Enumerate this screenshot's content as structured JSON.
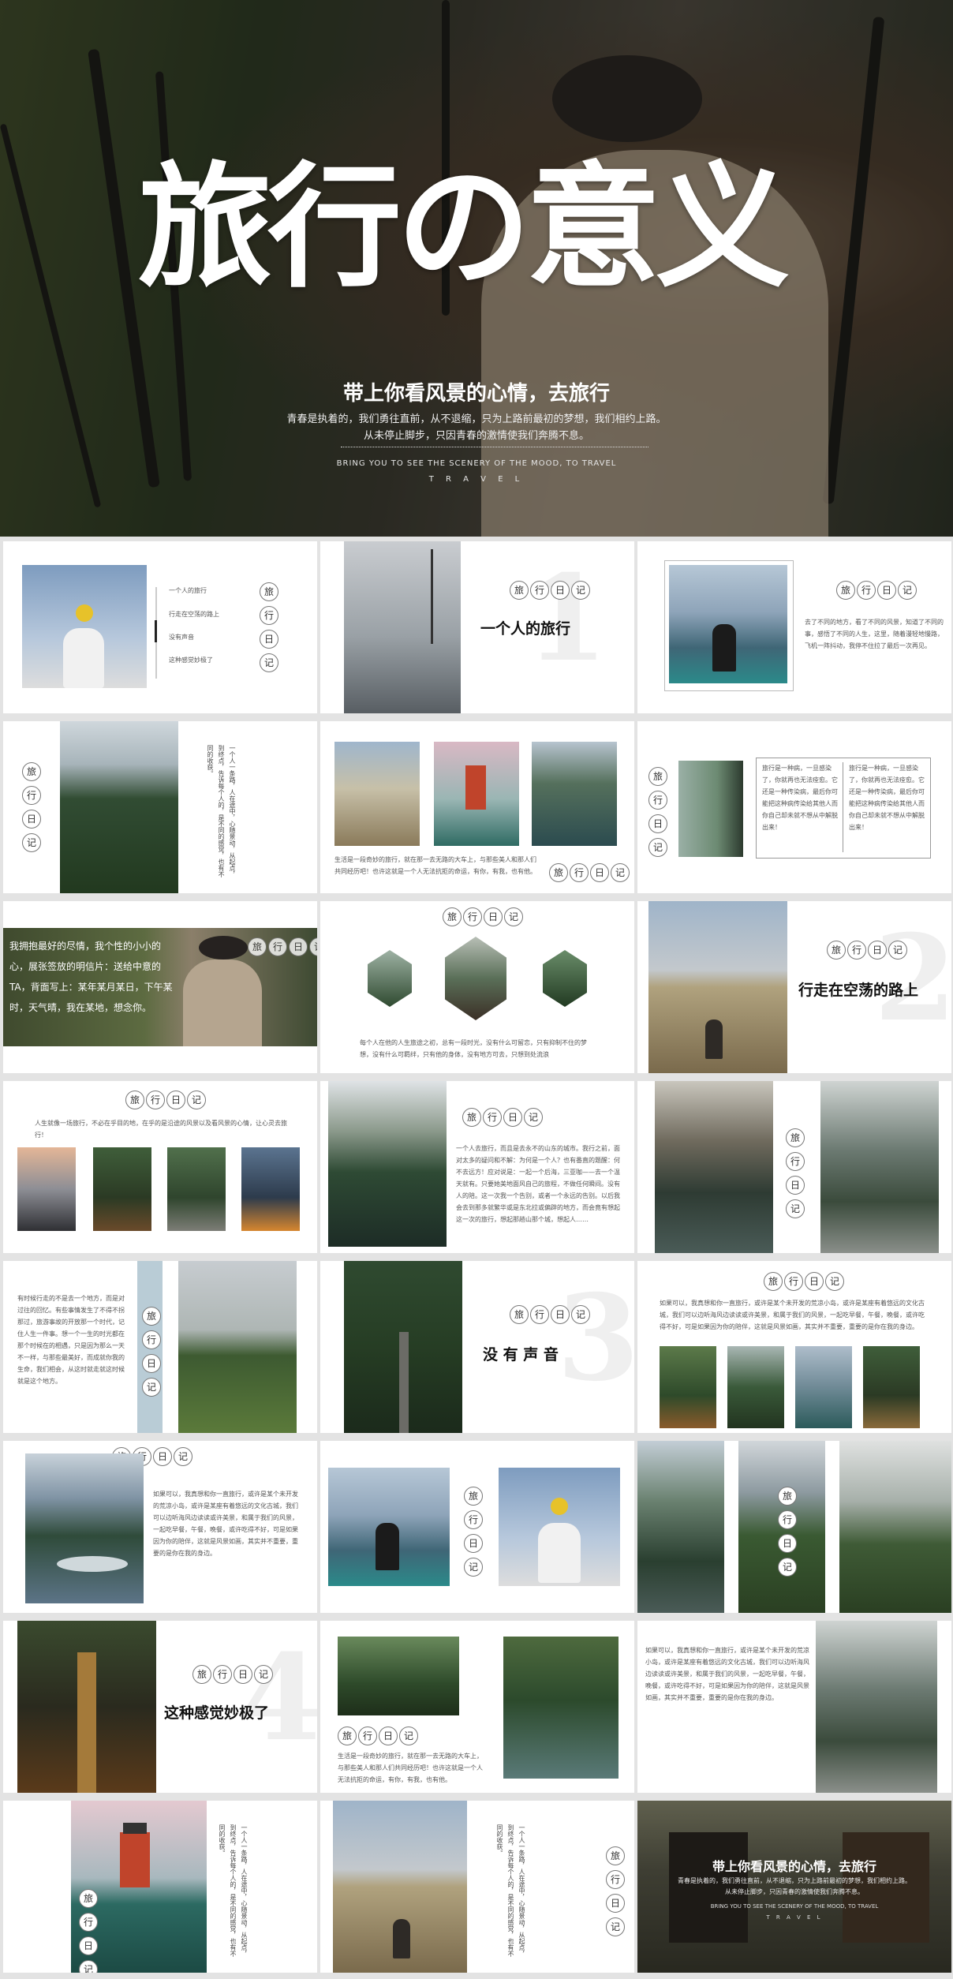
{
  "hero": {
    "title": "旅行の意义",
    "subtitle": "带上你看风景的心情，去旅行",
    "line1": "青春是执着的，我们勇往直前，从不退缩，只为上路前最初的梦想，我们相约上路。",
    "line2": "从未停止脚步，只因青春的激情使我们奔腾不息。",
    "en1": "BRING YOU TO SEE THE SCENERY OF THE MOOD, TO TRAVEL",
    "en2": "T R A V E L"
  },
  "badge": [
    "旅",
    "行",
    "日",
    "记"
  ],
  "toc": [
    "一个人的旅行",
    "行走在空荡的路上",
    "没有声音",
    "这种感觉妙极了"
  ],
  "sections": {
    "s1": {
      "num": "1",
      "title": "一个人的旅行"
    },
    "s2": {
      "num": "2",
      "title": "行走在空荡的路上"
    },
    "s3": {
      "num": "3",
      "title": "没 有 声 音"
    },
    "s4": {
      "num": "4",
      "title": "这种感觉妙极了"
    }
  },
  "texts": {
    "t1": "去了不同的地方，看了不同的风景，知道了不同的事，感悟了不同的人生，这里，随着漫轻地慢路，飞机一阵抖动，我停不住拉了最后一次再见。",
    "t2": "生活是一段奇妙的旅行，就在那一去无路的大车上，与那些美人和那人们共同经历吧！也许这就是一个人无法抗拒的命运，有你，有我，也有他。",
    "t3a": "旅行是一种病，一旦感染了，你就再也无法痊愈。它还是一种传染病，最后你可能把这种病传染给其他人而你自己却未就不想从中解脱出来！",
    "t3b": "旅行是一种病，一旦感染了，你就再也无法痊愈。它还是一种传染病，最后你可能把这种病传染给其他人而你自己却未就不想从中解脱出来！",
    "t4": "我拥抱最好的尽情，我个性的小小的心，展张签放的明信片：送给中意的TA，背面写上：某年某月某日，下午某时，天气晴，我在某地，想念你。",
    "t5": "每个人在他的人生旅途之初，总有一段时光，没有什么可留恋，只有抑制不住的梦想，没有什么可羁绊，只有他的身体，没有地方可去，只想到处流浪",
    "t6": "人生就像一场旅行，不必在乎目的地，在乎的是沿途的风景以及看风景的心情，让心灵去旅行！",
    "t7": "一个人去旅行，而且是去永不的山东的城市。我行之前，面对太多的疑问和不解：为何是一个人？也有番直的题醒：何不去远方！应对说是：一起一个后海，三亚咖——去一个温天就有。只要她美地面风自己的旅程，不做任何瞬间。没有人的陪。这一次我一个告别，或者一个永远的告别。以后我会去到那多就繁华或是东北拉或偏辟的地方，而会竟有想起这一次的旅行，想起那趟山那个城，想起人……",
    "t8": "有时候行走的不是去一个地方，而是对过往的回忆。有些事情发生了不得不拐那过，旅游事故的开放那一个时代，记住人生一件事。想一个一生的时光都在那个时候在的相遇，只是因为那么一天不一样，与那些最美好，而成就你我的生命，我们相会，从这时就走就这时候就是这个地方。",
    "t9": "如果可以，我真想和你一直旅行，或许是某个未开发的荒凉小岛，或许是某座有着悠远的文化古城，我们可以边听海风边读读或许美景，和属于我们的风景，一起吃早餐，午餐，晚餐，或许吃得不好，可是如果因为你的陪伴，这就是风景如画，其实并不重要，重要的是你在我的身边。",
    "t10": "如果可以，我真想和你一直旅行，或许是某个未开发的荒凉小岛，或许是某座有着悠远的文化古城，我们可以边听海风边读读或许美景，和属于我们的风景，一起吃早餐，午餐，晚餐，或许吃得不好，可是如果因为你的陪伴，这就是风景如画，其实并不重要，重要的是你在我的身边。",
    "t11": "生活是一段奇妙的旅行，就在那一去无路的大车上，与那些美人和那人们共同经历吧！也许这就是一个人无法抗拒的命运，有你，有我，也有他。",
    "t12": "如果可以，我真想和你一直旅行，或许是某个未开发的荒凉小岛，或许是某座有着悠远的文化古城，我们可以边听海风边读读或许美景，和属于我们的风景，一起吃早餐，午餐，晚餐，或许吃得不好，可是如果因为你的陪伴，这就是风景如画，其实并不重要，重要的是你在我的身边。",
    "v1": "一个人一条路，人在途中，心随景动，从起点，到终点，告诉每个人的，是不同的感觉，也有不同的收获。",
    "v2": "一个人一条路，人在途中，心随景动，从起点，到终点，告诉每个人的，是不同的感觉，也有不同的收获。",
    "v3": "一个人一条路，人在途中，心随景动，从起点，到终点，告诉每个人的，是不同的感觉，也有不同的收获。"
  },
  "colors": {
    "sky": "#8fa8c4",
    "forest": "#2f4a30",
    "boat": "#2b8a8a",
    "lighthouse": "#c0442b"
  }
}
